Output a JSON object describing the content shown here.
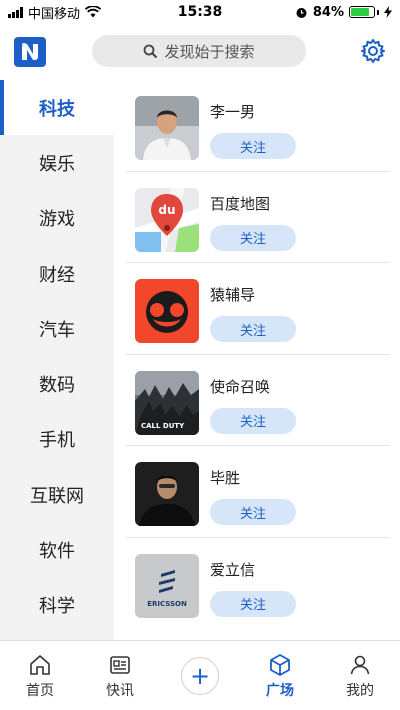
{
  "status_bar": {
    "carrier": "中国移动",
    "time": "15:38",
    "battery_percent": "84%",
    "battery_level": 0.84
  },
  "header": {
    "search_placeholder": "发现始于搜索",
    "icons": [
      "app-logo",
      "search-icon",
      "settings-gear-icon"
    ]
  },
  "categories": [
    {
      "label": "科技",
      "active": true
    },
    {
      "label": "娱乐"
    },
    {
      "label": "游戏"
    },
    {
      "label": "财经"
    },
    {
      "label": "汽车"
    },
    {
      "label": "数码"
    },
    {
      "label": "手机"
    },
    {
      "label": "互联网"
    },
    {
      "label": "软件"
    },
    {
      "label": "科学"
    }
  ],
  "items": [
    {
      "name": "李一男",
      "follow_label": "关注",
      "thumb": "person-photo"
    },
    {
      "name": "百度地图",
      "follow_label": "关注",
      "thumb": "map-logo",
      "logo_text": "du"
    },
    {
      "name": "猿辅导",
      "follow_label": "关注",
      "thumb": "monkey-logo"
    },
    {
      "name": "使命召唤",
      "follow_label": "关注",
      "thumb": "game-cover",
      "logo_text": "CALL DUTY"
    },
    {
      "name": "毕胜",
      "follow_label": "关注",
      "thumb": "person-photo-dark"
    },
    {
      "name": "爱立信",
      "follow_label": "关注",
      "thumb": "ericsson-logo",
      "logo_text": "ERICSSON"
    }
  ],
  "bottom_nav": [
    {
      "label": "首页",
      "icon": "home-icon"
    },
    {
      "label": "快讯",
      "icon": "news-icon"
    },
    {
      "label": "+",
      "icon": "plus-icon"
    },
    {
      "label": "广场",
      "icon": "cube-icon",
      "active": true
    },
    {
      "label": "我的",
      "icon": "person-icon"
    }
  ],
  "colors": {
    "accent": "#1e5fc7",
    "follow_bg": "#d6e6f8",
    "sidebar_bg": "#f3f3f4"
  }
}
